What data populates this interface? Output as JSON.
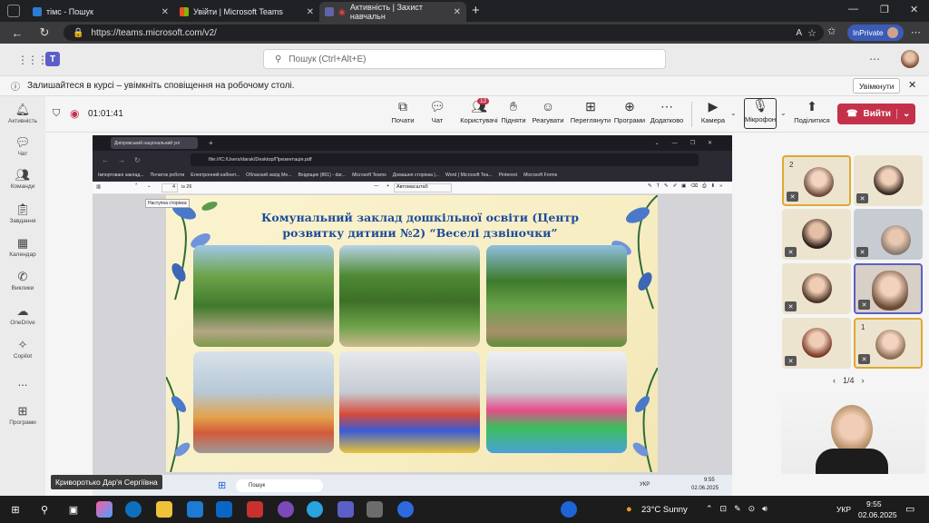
{
  "browser": {
    "tabs": [
      {
        "title": "тімс - Пошук",
        "color": "#2d7bd6"
      },
      {
        "title": "Увійти | Microsoft Teams",
        "color": "#f25022"
      },
      {
        "title": "Активність | Захист навчальн",
        "color": "#6264a7"
      }
    ],
    "url": "https://teams.microsoft.com/v2/",
    "inprivate": "InPrivate"
  },
  "teams": {
    "search_placeholder": "Пошук (Ctrl+Alt+E)",
    "notification": "Залишайтеся в курсі – увімкніть сповіщення на робочому столі.",
    "notification_button": "Увімкнути",
    "rail": [
      {
        "label": "Активність",
        "icon": "bell-icon"
      },
      {
        "label": "Чат",
        "icon": "chat-icon"
      },
      {
        "label": "Команди",
        "icon": "teams-icon"
      },
      {
        "label": "Завдання",
        "icon": "assignments-icon"
      },
      {
        "label": "Календар",
        "icon": "calendar-icon"
      },
      {
        "label": "Виклики",
        "icon": "phone-icon"
      },
      {
        "label": "OneDrive",
        "icon": "cloud-icon"
      },
      {
        "label": "Copilot",
        "icon": "copilot-icon"
      },
      {
        "label": "...",
        "icon": "more-icon"
      },
      {
        "label": "Програми",
        "icon": "apps-icon"
      }
    ],
    "timer": "01:01:41",
    "toolbar": [
      {
        "label": "Почати",
        "icon": "present-icon"
      },
      {
        "label": "Чат",
        "icon": "chat-icon"
      },
      {
        "label": "Користувачі",
        "icon": "people-icon",
        "badge": "12"
      },
      {
        "label": "Підняти",
        "icon": "hand-icon"
      },
      {
        "label": "Реагувати",
        "icon": "smile-icon"
      },
      {
        "label": "Переглянути",
        "icon": "view-icon"
      },
      {
        "label": "Програми",
        "icon": "plus-icon"
      },
      {
        "label": "Додатково",
        "icon": "more-icon"
      },
      {
        "label": "Камера",
        "icon": "camera-icon"
      },
      {
        "label": "Мікрофон",
        "icon": "mic-icon"
      },
      {
        "label": "Поділитися",
        "icon": "share-icon"
      }
    ],
    "leave": "Вийти",
    "presenter_name": "Криворотько Дар'я Сергіївна",
    "gallery_page": "1/4",
    "tile_badges": [
      "2",
      "1"
    ]
  },
  "shared": {
    "tab_title": "Дніпровський національний уні",
    "file_path": "file:///C:/Users/darak/Desktop/Презентація.pdf",
    "bookmarks": [
      "Імпортовані заклад...",
      "Початок роботи",
      "Електронний кабінет...",
      "Обласний захід Ме...",
      "Вхідящих (861) - dar...",
      "Microsoft Teams",
      "Домашня сторінка |...",
      "Word | Microsoft Tea...",
      "Pinterest",
      "Microsoft Forms"
    ],
    "page_num": "4",
    "page_total": "із 26",
    "zoom": "Автомасштаб",
    "tooltip": "Наступна сторінка",
    "slide_title": "Комунальний заклад дошкільної освіти (Центр розвитку дитини №2) “Веселі дзвіночки”",
    "inner_search": "Пошук",
    "inner_lang": "УКР",
    "inner_time": "9:55",
    "inner_date": "02.06.2025"
  },
  "taskbar": {
    "weather": "23°C Sunny",
    "lang": "УКР",
    "time": "9:55",
    "date": "02.06.2025"
  }
}
